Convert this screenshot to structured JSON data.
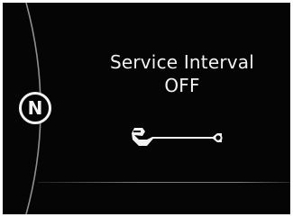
{
  "display": {
    "gear": "N",
    "message": {
      "title": "Service Interval",
      "status": "OFF"
    },
    "icon": "wrench-icon"
  },
  "colors": {
    "background": "#050505",
    "text": "#f2f2f2",
    "frame": "#ffffff"
  }
}
